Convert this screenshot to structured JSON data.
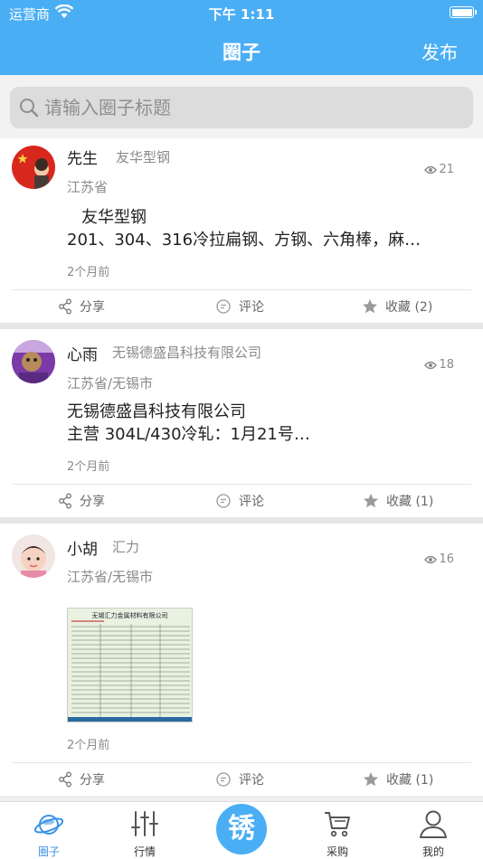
{
  "status_bar": {
    "carrier": "运营商",
    "time": "下午 1:11"
  },
  "nav": {
    "title": "圈子",
    "publish": "发布"
  },
  "search": {
    "placeholder": "请输入圈子标题"
  },
  "posts": [
    {
      "name": "先生",
      "company": "友华型钢",
      "region": "江苏省",
      "views": "21",
      "content": [
        "友华型钢",
        "201、304、316冷拉扁钢、方钢、六角棒，麻…"
      ],
      "time_ago": "2个月前",
      "share": "分享",
      "comment": "评论",
      "favorite": "收藏 (2)"
    },
    {
      "name": "心雨",
      "company": "无锡德盛昌科技有限公司",
      "region": "江苏省/无锡市",
      "views": "18",
      "content": [
        "无锡德盛昌科技有限公司",
        "主营 304L/430冷轧：1月21号…"
      ],
      "time_ago": "2个月前",
      "share": "分享",
      "comment": "评论",
      "favorite": "收藏 (1)"
    },
    {
      "name": "小胡",
      "company": "汇力",
      "region": "江苏省/无锡市",
      "views": "16",
      "image_title": "无锡汇力金属材料有限公司",
      "time_ago": "2个月前",
      "share": "分享",
      "comment": "评论",
      "favorite": "收藏 (1)"
    }
  ],
  "tabs": [
    {
      "label": "圈子",
      "icon": "planet-icon",
      "active": true
    },
    {
      "label": "行情",
      "icon": "sliders-icon"
    },
    {
      "label": "锈",
      "icon": "center-logo"
    },
    {
      "label": "采购",
      "icon": "cart-icon"
    },
    {
      "label": "我的",
      "icon": "user-icon"
    }
  ],
  "colors": {
    "accent": "#4aaef5",
    "active_tab": "#3a93e6"
  }
}
